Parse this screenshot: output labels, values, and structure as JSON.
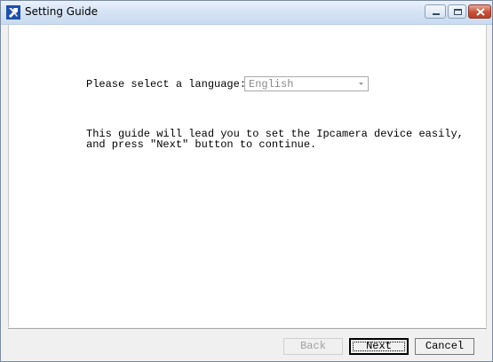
{
  "window": {
    "title": "Setting Guide",
    "icons": {
      "app": "wrench-tools-icon",
      "minimize": "minimize-icon",
      "maximize": "maximize-icon",
      "close": "close-icon"
    },
    "colors": {
      "titlebar": "#d7e4f4",
      "close_button": "#c7503a",
      "client_background": "#ffffff"
    }
  },
  "language": {
    "label": "Please select a language:",
    "selected": "English",
    "enabled": false,
    "dropdown_icon": "chevron-down-icon"
  },
  "guide": {
    "line1": "This guide will lead you to set the Ipcamera device easily,",
    "line2": "and press \"Next\" button to continue."
  },
  "buttons": {
    "back": {
      "label": "Back",
      "enabled": false
    },
    "next": {
      "label": "Next",
      "enabled": true,
      "default": true
    },
    "cancel": {
      "label": "Cancel",
      "enabled": true
    }
  }
}
